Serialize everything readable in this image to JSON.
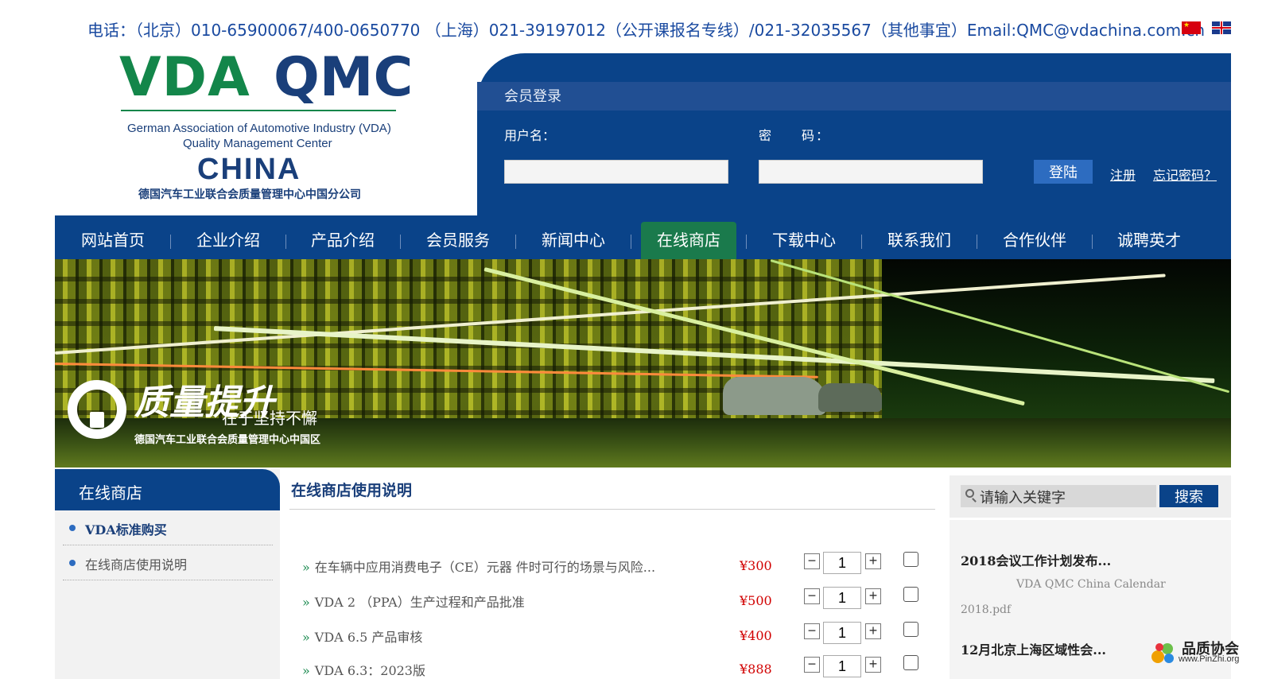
{
  "contact": {
    "text": "电话：（北京）010-65900067/400-0650770 （上海）021-39197012（公开课报名专线）/021-32035567（其他事宜）Email:QMC@vdachina.com.cn"
  },
  "logo": {
    "vda": "VDA",
    "qmc": "QMC",
    "eng_line1": "German Association of Automotive Industry (VDA)",
    "eng_line2": "Quality Management Center",
    "china": "CHINA",
    "cn_line": "德国汽车工业联合会质量管理中心中国分公司"
  },
  "login": {
    "title": "会员登录",
    "username_label": "用户名：",
    "password_label": "密　　码：",
    "login_button": "登陆",
    "register_link": "注册",
    "forgot_link": "忘记密码？"
  },
  "nav": {
    "items": [
      "网站首页",
      "企业介绍",
      "产品介绍",
      "会员服务",
      "新闻中心",
      "在线商店",
      "下载中心",
      "联系我们",
      "合作伙伴",
      "诚聘英才"
    ],
    "active": "在线商店"
  },
  "banner": {
    "slogan_main": "质量提升",
    "slogan_sub": "在于坚持不懈",
    "slogan_org": "德国汽车工业联合会质量管理中心中国区"
  },
  "sidebar": {
    "title": "在线商店",
    "items": [
      "VDA标准购买",
      "在线商店使用说明"
    ]
  },
  "main": {
    "title": "在线商店使用说明",
    "products": [
      {
        "name": "在车辆中应用消费电子（CE）元器 件时可行的场景与风险...",
        "price": "¥300",
        "qty": "1"
      },
      {
        "name": "VDA 2 （PPA）生产过程和产品批准",
        "price": "¥500",
        "qty": "1"
      },
      {
        "name": "VDA 6.5 产品审核",
        "price": "¥400",
        "qty": "1"
      },
      {
        "name": "VDA 6.3：2023版",
        "price": "¥888",
        "qty": "1"
      }
    ]
  },
  "right": {
    "search_placeholder": "请输入关键字",
    "search_button": "搜索",
    "news": [
      {
        "title": "2018会议工作计划发布...",
        "desc1": "VDA QMC China Calendar",
        "desc2": "2018.pdf"
      },
      {
        "title": "12月北京上海区域性会..."
      }
    ]
  },
  "watermark": {
    "name": "品质协会",
    "url": "www.PinZhi.org"
  },
  "colors": {
    "primary_blue": "#0a4389",
    "active_green": "#1a7a4c",
    "price_red": "#d10000",
    "brand_green": "#13864a"
  }
}
